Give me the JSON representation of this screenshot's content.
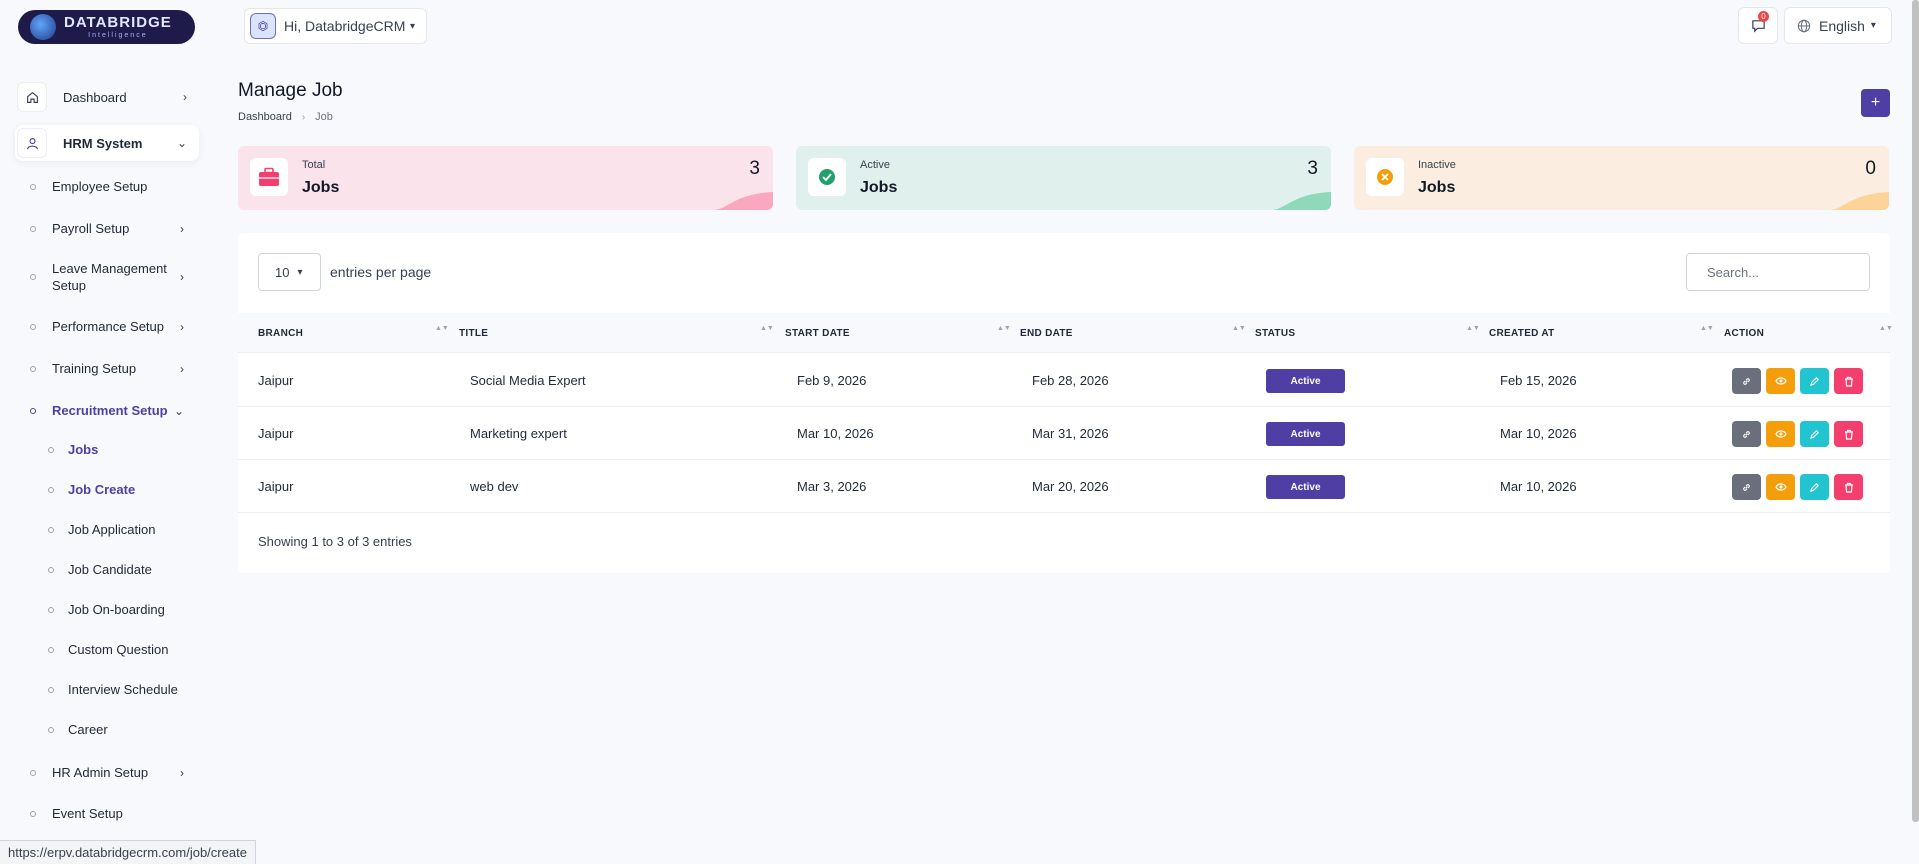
{
  "brand": {
    "name": "DATABRIDGE",
    "tagline": "Intelligence"
  },
  "header": {
    "user_label": "Hi, DatabridgeCRM!",
    "notification_count": "0",
    "language": "English"
  },
  "sidebar": {
    "dashboard": "Dashboard",
    "hrm": "HRM System",
    "items": [
      "Employee Setup",
      "Payroll Setup",
      "Leave Management Setup",
      "Performance Setup",
      "Training Setup",
      "Recruitment Setup"
    ],
    "sub_items": [
      "Jobs",
      "Job Create",
      "Job Application",
      "Job Candidate",
      "Job On-boarding",
      "Custom Question",
      "Interview Schedule",
      "Career"
    ],
    "hr_admin": "HR Admin Setup",
    "event": "Event Setup"
  },
  "page": {
    "title": "Manage Job",
    "breadcrumb": [
      "Dashboard",
      "Job"
    ],
    "add_label": "+"
  },
  "stats": {
    "total": {
      "caption": "Total",
      "label": "Jobs",
      "value": "3"
    },
    "active": {
      "caption": "Active",
      "label": "Jobs",
      "value": "3"
    },
    "inactive": {
      "caption": "Inactive",
      "label": "Jobs",
      "value": "0"
    }
  },
  "table": {
    "per_page": "10",
    "per_page_label": "entries per page",
    "search_placeholder": "Search...",
    "columns": [
      "BRANCH",
      "TITLE",
      "START DATE",
      "END DATE",
      "STATUS",
      "CREATED AT",
      "ACTION"
    ],
    "rows": [
      {
        "branch": "Jaipur",
        "title": "Social Media Expert",
        "start": "Feb 9, 2026",
        "end": "Feb 28, 2026",
        "status": "Active",
        "created": "Feb 15, 2026"
      },
      {
        "branch": "Jaipur",
        "title": "Marketing expert",
        "start": "Mar 10, 2026",
        "end": "Mar 31, 2026",
        "status": "Active",
        "created": "Mar 10, 2026"
      },
      {
        "branch": "Jaipur",
        "title": "web dev",
        "start": "Mar 3, 2026",
        "end": "Mar 20, 2026",
        "status": "Active",
        "created": "Mar 10, 2026"
      }
    ],
    "footer": "Showing 1 to 3 of 3 entries"
  },
  "statusbar": {
    "url": "https://erpv.databridgecrm.com/job/create"
  },
  "colors": {
    "accent": "#4f3ea3",
    "total": "#fae3ea",
    "active": "#e0f1ed",
    "inactive": "#fbeee0"
  }
}
